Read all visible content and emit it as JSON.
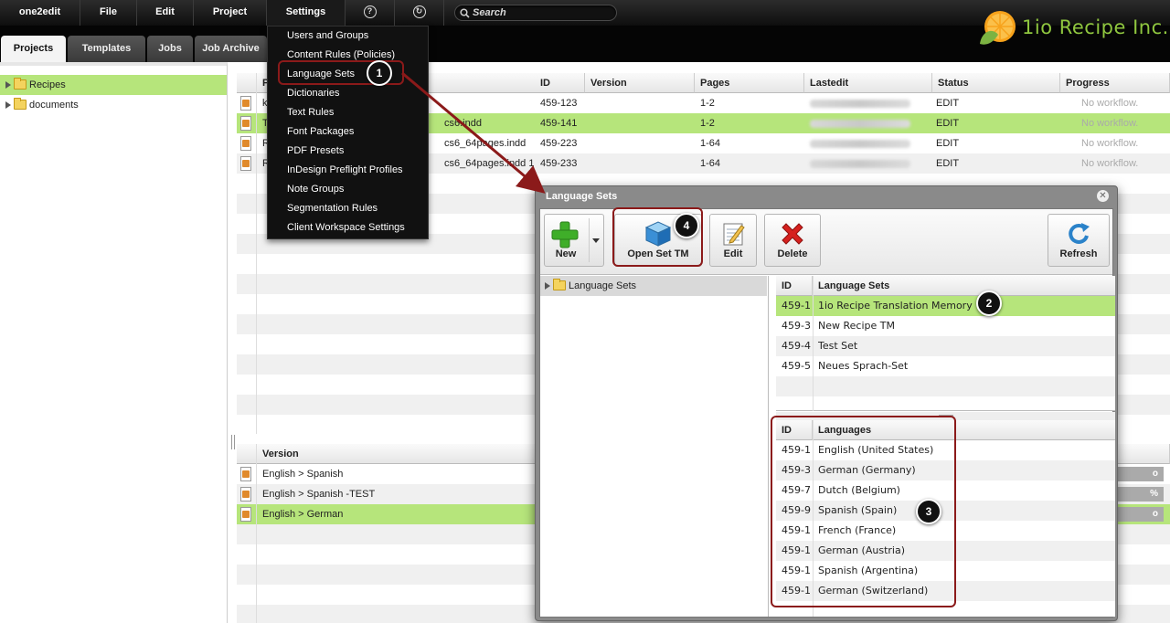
{
  "menubar": {
    "items": [
      {
        "label": "one2edit"
      },
      {
        "label": "File"
      },
      {
        "label": "Edit"
      },
      {
        "label": "Project"
      },
      {
        "label": "Settings"
      }
    ],
    "help_glyph": "?",
    "refresh_glyph": "↻",
    "search_placeholder": "Search"
  },
  "tabs": [
    {
      "label": "Projects"
    },
    {
      "label": "Templates"
    },
    {
      "label": "Jobs"
    },
    {
      "label": "Job Archive"
    }
  ],
  "logo": {
    "text": "1io Recipe Inc.",
    "color": "#8fc63f"
  },
  "tree": {
    "items": [
      {
        "label": "Recipes"
      },
      {
        "label": "documents"
      }
    ]
  },
  "projects_table": {
    "headers": [
      "P",
      "ID",
      "Version",
      "Pages",
      "Lastedit",
      "Status",
      "Progress"
    ],
    "rows": [
      {
        "name_start": "ko",
        "name_end": "",
        "id": "459-123",
        "version": "",
        "pages": "1-2",
        "status": "EDIT",
        "progress": "No workflow."
      },
      {
        "name_start": "T",
        "name_end": "cs6.indd",
        "id": "459-141",
        "version": "",
        "pages": "1-2",
        "status": "EDIT",
        "progress": "No workflow."
      },
      {
        "name_start": "R",
        "name_end": "cs6_64pages.indd",
        "id": "459-223",
        "version": "",
        "pages": "1-64",
        "status": "EDIT",
        "progress": "No workflow."
      },
      {
        "name_start": "R",
        "name_end": "cs6_64pages.indd 1",
        "id": "459-233",
        "version": "",
        "pages": "1-64",
        "status": "EDIT",
        "progress": "No workflow."
      }
    ]
  },
  "version_table": {
    "header": "Version",
    "rows": [
      {
        "label": "English > Spanish",
        "tail": "o"
      },
      {
        "label": "English > Spanish -TEST",
        "tail": "%"
      },
      {
        "label": "English > German",
        "tail": "o"
      }
    ]
  },
  "settings_menu": {
    "items": [
      "Users and Groups",
      "Content Rules (Policies)",
      "Language Sets",
      "Dictionaries",
      "Text Rules",
      "Font Packages",
      "PDF Presets",
      "InDesign Preflight Profiles",
      "Note Groups",
      "Segmentation Rules",
      "Client Workspace Settings"
    ]
  },
  "dialog": {
    "title": "Language Sets",
    "close_glyph": "✕",
    "toolbar": {
      "new_label": "New",
      "open_set_tm_label": "Open Set TM",
      "edit_label": "Edit",
      "delete_label": "Delete",
      "refresh_label": "Refresh"
    },
    "tree_root": "Language Sets",
    "sets_table": {
      "headers": [
        "ID",
        "Language Sets"
      ],
      "rows": [
        {
          "id": "459-1",
          "name": "1io Recipe Translation Memory"
        },
        {
          "id": "459-3",
          "name": "New Recipe TM"
        },
        {
          "id": "459-4",
          "name": "Test Set"
        },
        {
          "id": "459-5",
          "name": "Neues Sprach-Set"
        }
      ]
    },
    "languages_table": {
      "headers": [
        "ID",
        "Languages"
      ],
      "rows": [
        {
          "id": "459-1",
          "name": "English (United States)"
        },
        {
          "id": "459-3",
          "name": "German (Germany)"
        },
        {
          "id": "459-7",
          "name": "Dutch (Belgium)"
        },
        {
          "id": "459-9",
          "name": "Spanish (Spain)"
        },
        {
          "id": "459-1",
          "name": "French (France)"
        },
        {
          "id": "459-1(",
          "name": "German (Austria)"
        },
        {
          "id": "459-1",
          "name": "Spanish (Argentina)"
        },
        {
          "id": "459-1",
          "name": "German (Switzerland)"
        }
      ]
    }
  },
  "annotations": [
    "1",
    "2",
    "3",
    "4"
  ],
  "colors": {
    "selection": "#b6e57b",
    "highlight": "#8b1a1a",
    "menubar": "#111111"
  }
}
